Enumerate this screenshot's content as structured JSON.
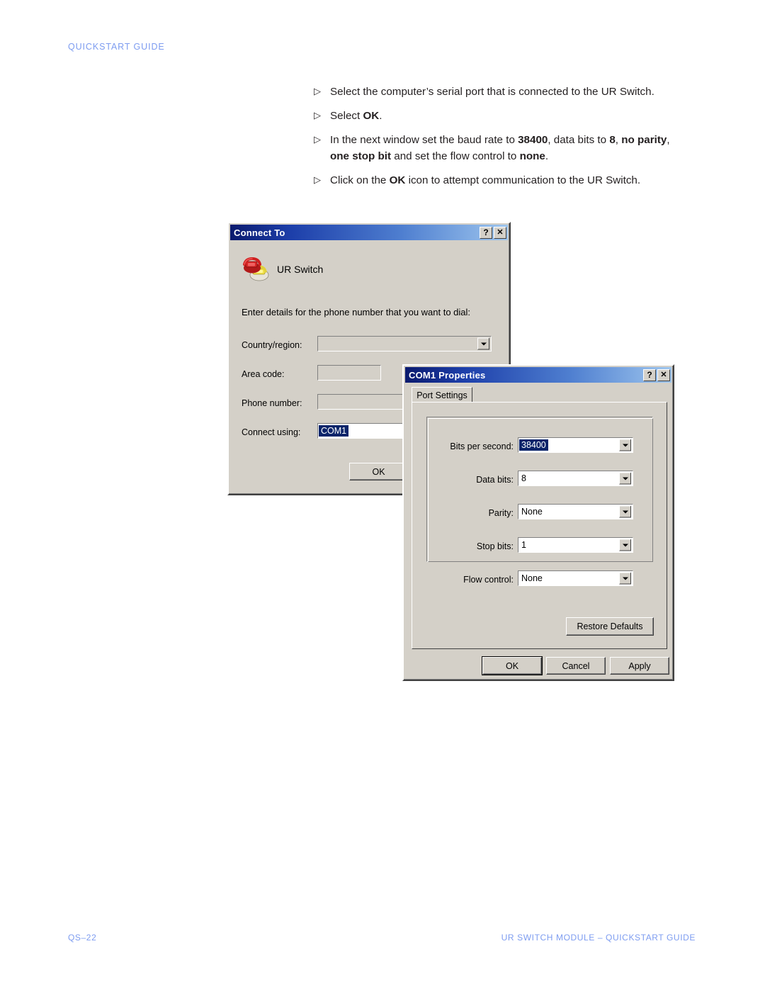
{
  "page": {
    "header": "QUICKSTART GUIDE",
    "footer_left": "QS–22",
    "footer_right": "UR SWITCH MODULE – QUICKSTART GUIDE",
    "accent_color": "#7d9cf0"
  },
  "instructions": {
    "marker": "▷",
    "items": [
      {
        "id": "select-serial-port",
        "parts": [
          {
            "text": "Select the computer’s serial port that is connected to the UR Switch.",
            "bold": false
          }
        ]
      },
      {
        "id": "select-ok",
        "parts": [
          {
            "text": "Select ",
            "bold": false
          },
          {
            "text": "OK",
            "bold": true
          },
          {
            "text": ".",
            "bold": false
          }
        ]
      },
      {
        "id": "set-baud-rate",
        "parts": [
          {
            "text": "In the next window set the baud rate to ",
            "bold": false
          },
          {
            "text": "38400",
            "bold": true
          },
          {
            "text": ", data bits to ",
            "bold": false
          },
          {
            "text": "8",
            "bold": true
          },
          {
            "text": ", ",
            "bold": false
          },
          {
            "text": "no parity",
            "bold": true
          },
          {
            "text": ", ",
            "bold": false
          },
          {
            "text": "one stop bit",
            "bold": true
          },
          {
            "text": " and set the flow control to ",
            "bold": false
          },
          {
            "text": "none",
            "bold": true
          },
          {
            "text": ".",
            "bold": false
          }
        ]
      },
      {
        "id": "click-ok-icon",
        "parts": [
          {
            "text": "Click on the ",
            "bold": false
          },
          {
            "text": "OK",
            "bold": true
          },
          {
            "text": " icon to attempt communication to the UR Switch.",
            "bold": false
          }
        ]
      }
    ]
  },
  "connect_to_dialog": {
    "title": "Connect To",
    "help_button": "?",
    "close_button": "✕",
    "icon_name": "telephone-icon",
    "connection_name": "UR Switch",
    "prompt": "Enter details for the phone number that you want to dial:",
    "fields": [
      {
        "label": "Country/region:",
        "value": "",
        "combo": true
      },
      {
        "label": "Area code:",
        "value": "",
        "combo": false
      },
      {
        "label": "Phone number:",
        "value": "",
        "combo": false
      },
      {
        "label": "Connect using:",
        "value": "COM1",
        "combo": true,
        "selected": true
      }
    ],
    "ok_button": "OK"
  },
  "com1_properties_dialog": {
    "title": "COM1 Properties",
    "help_button": "?",
    "close_button": "✕",
    "tab": "Port Settings",
    "settings": [
      {
        "label": "Bits per second:",
        "value": "38400",
        "selected": true
      },
      {
        "label": "Data bits:",
        "value": "8",
        "selected": false
      },
      {
        "label": "Parity:",
        "value": "None",
        "selected": false
      },
      {
        "label": "Stop bits:",
        "value": "1",
        "selected": false
      },
      {
        "label": "Flow control:",
        "value": "None",
        "selected": false
      }
    ],
    "restore_defaults_button": "Restore Defaults",
    "ok_button": "OK",
    "cancel_button": "Cancel",
    "apply_button": "Apply"
  }
}
